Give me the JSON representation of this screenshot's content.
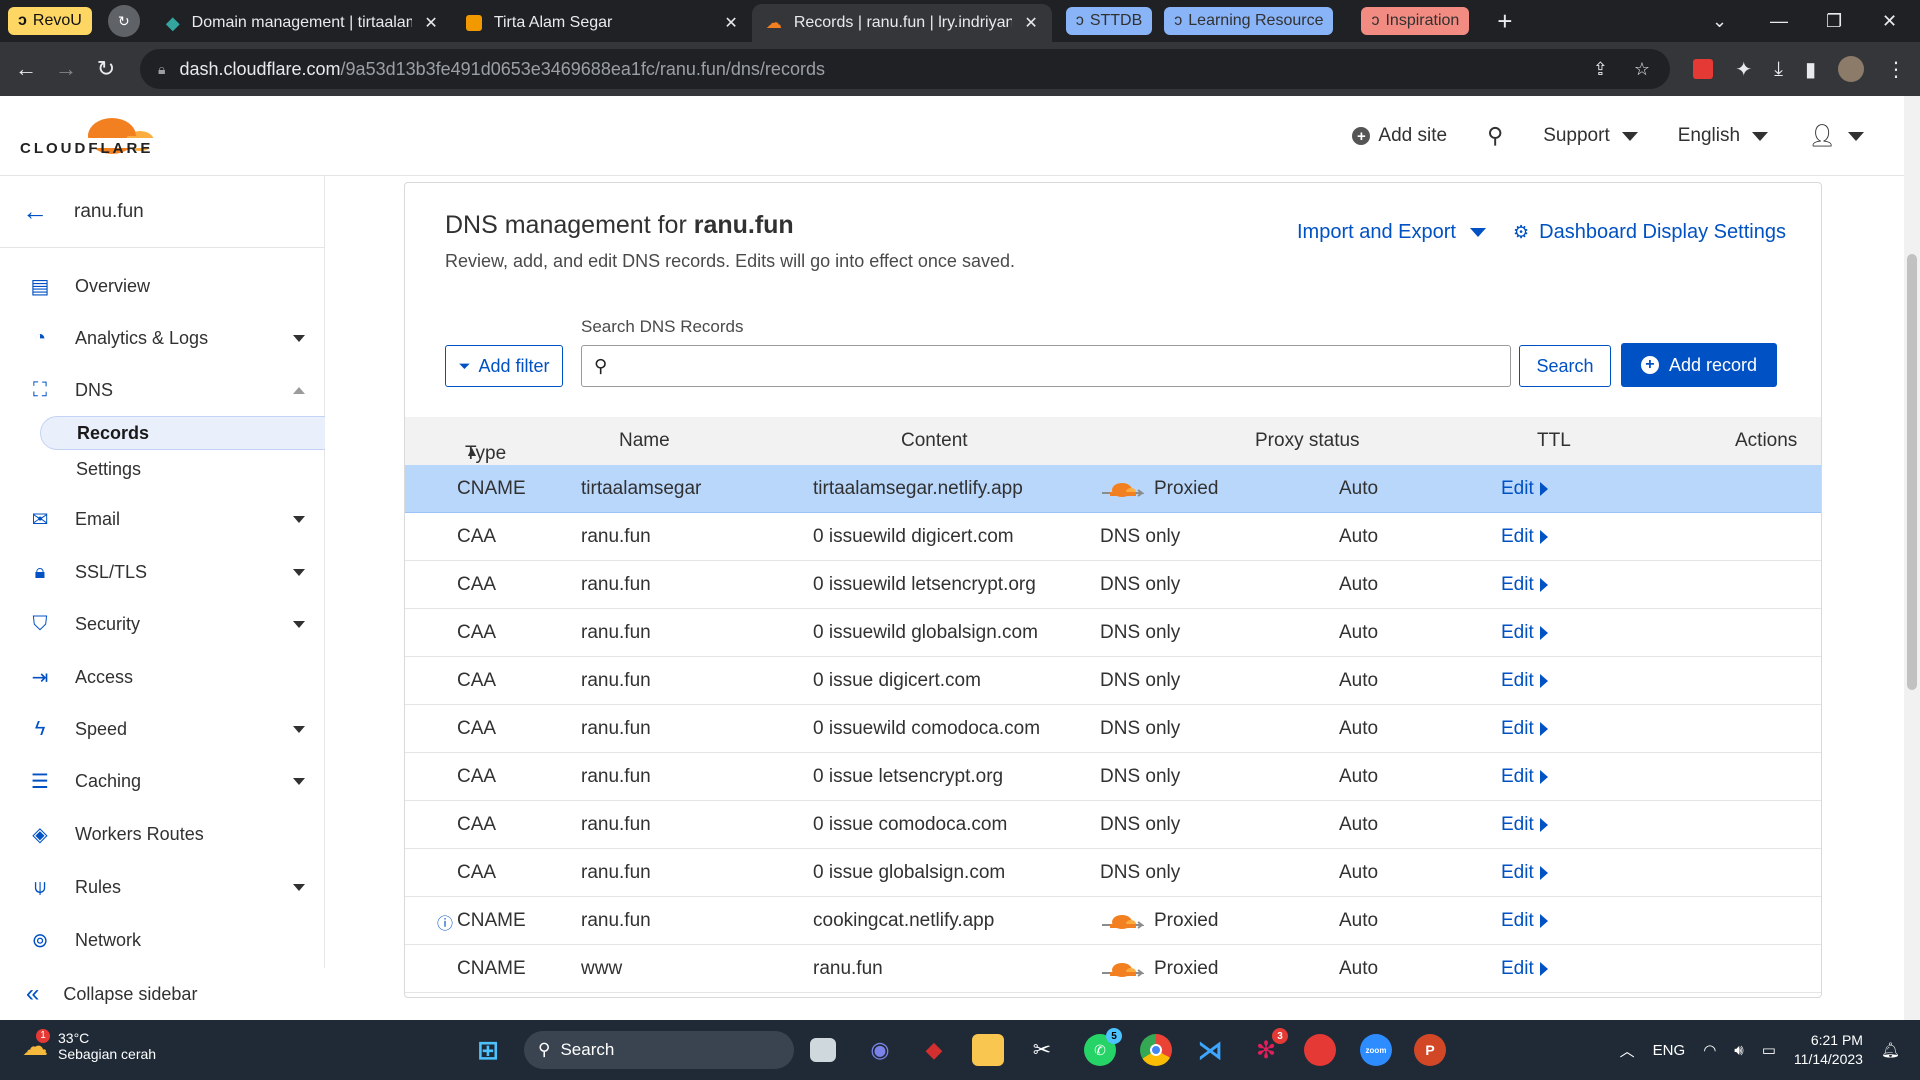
{
  "browser": {
    "pinned_tab": "RevoU",
    "tabs": [
      {
        "label": "Domain management | tirtaalam"
      },
      {
        "label": "Tirta Alam Segar"
      },
      {
        "label": "Records | ranu.fun | lry.indriyanto"
      }
    ],
    "groups": [
      {
        "label": "STTDB",
        "color": "#8ab4f8"
      },
      {
        "label": "Learning Resource",
        "color": "#8ab4f8"
      },
      {
        "label": "Inspiration",
        "color": "#f28b82"
      }
    ],
    "url_host": "dash.cloudflare.com",
    "url_path": "/9a53d13b3fe491d0653e3469688ea1fc/ranu.fun/dns/records"
  },
  "header": {
    "logo_text": "CLOUDFLARE",
    "add_site": "Add site",
    "support": "Support",
    "language": "English"
  },
  "sidebar": {
    "domain": "ranu.fun",
    "items": [
      {
        "label": "Overview",
        "icon": "document-icon"
      },
      {
        "label": "Analytics & Logs",
        "icon": "chart-icon"
      },
      {
        "label": "DNS",
        "icon": "network-icon"
      },
      {
        "label": "Email",
        "icon": "email-icon"
      },
      {
        "label": "SSL/TLS",
        "icon": "lock-icon"
      },
      {
        "label": "Security",
        "icon": "shield-icon"
      },
      {
        "label": "Access",
        "icon": "access-icon"
      },
      {
        "label": "Speed",
        "icon": "bolt-icon"
      },
      {
        "label": "Caching",
        "icon": "storage-icon"
      },
      {
        "label": "Workers Routes",
        "icon": "workers-icon"
      },
      {
        "label": "Rules",
        "icon": "rules-icon"
      },
      {
        "label": "Network",
        "icon": "location-icon"
      }
    ],
    "dns_sub": [
      "Records",
      "Settings"
    ],
    "collapse": "Collapse sidebar"
  },
  "main": {
    "title_prefix": "DNS management for ",
    "title_domain": "ranu.fun",
    "description": "Review, add, and edit DNS records. Edits will go into effect once saved.",
    "import_export": "Import and Export",
    "display_settings": "Dashboard Display Settings",
    "search_label": "Search DNS Records",
    "add_filter": "Add filter",
    "search_button": "Search",
    "add_record": "Add record",
    "columns": [
      "Type",
      "Name",
      "Content",
      "Proxy status",
      "TTL",
      "Actions"
    ],
    "edit_label": "Edit",
    "rows": [
      {
        "type": "CNAME",
        "name": "tirtaalamsegar",
        "content": "tirtaalamsegar.netlify.app",
        "proxy": "Proxied",
        "ttl": "Auto"
      },
      {
        "type": "CAA",
        "name": "ranu.fun",
        "content": "0 issuewild digicert.com",
        "proxy": "DNS only",
        "ttl": "Auto"
      },
      {
        "type": "CAA",
        "name": "ranu.fun",
        "content": "0 issuewild letsencrypt.org",
        "proxy": "DNS only",
        "ttl": "Auto"
      },
      {
        "type": "CAA",
        "name": "ranu.fun",
        "content": "0 issuewild globalsign.com",
        "proxy": "DNS only",
        "ttl": "Auto"
      },
      {
        "type": "CAA",
        "name": "ranu.fun",
        "content": "0 issue digicert.com",
        "proxy": "DNS only",
        "ttl": "Auto"
      },
      {
        "type": "CAA",
        "name": "ranu.fun",
        "content": "0 issuewild comodoca.com",
        "proxy": "DNS only",
        "ttl": "Auto"
      },
      {
        "type": "CAA",
        "name": "ranu.fun",
        "content": "0 issue letsencrypt.org",
        "proxy": "DNS only",
        "ttl": "Auto"
      },
      {
        "type": "CAA",
        "name": "ranu.fun",
        "content": "0 issue comodoca.com",
        "proxy": "DNS only",
        "ttl": "Auto"
      },
      {
        "type": "CAA",
        "name": "ranu.fun",
        "content": "0 issue globalsign.com",
        "proxy": "DNS only",
        "ttl": "Auto"
      },
      {
        "type": "CNAME",
        "name": "ranu.fun",
        "content": "cookingcat.netlify.app",
        "proxy": "Proxied",
        "ttl": "Auto"
      },
      {
        "type": "CNAME",
        "name": "www",
        "content": "ranu.fun",
        "proxy": "Proxied",
        "ttl": "Auto"
      }
    ]
  },
  "taskbar": {
    "temp": "33°C",
    "weather": "Sebagian cerah",
    "search": "Search",
    "lang": "ENG",
    "time": "6:21 PM",
    "date": "11/14/2023",
    "weather_badge": "1",
    "badge_whatsapp": "5",
    "badge_slack": "3"
  },
  "colors": {
    "accent": "#0051c3",
    "proxied_orange": "#f38020",
    "selected_row": "#b9d6fb"
  }
}
